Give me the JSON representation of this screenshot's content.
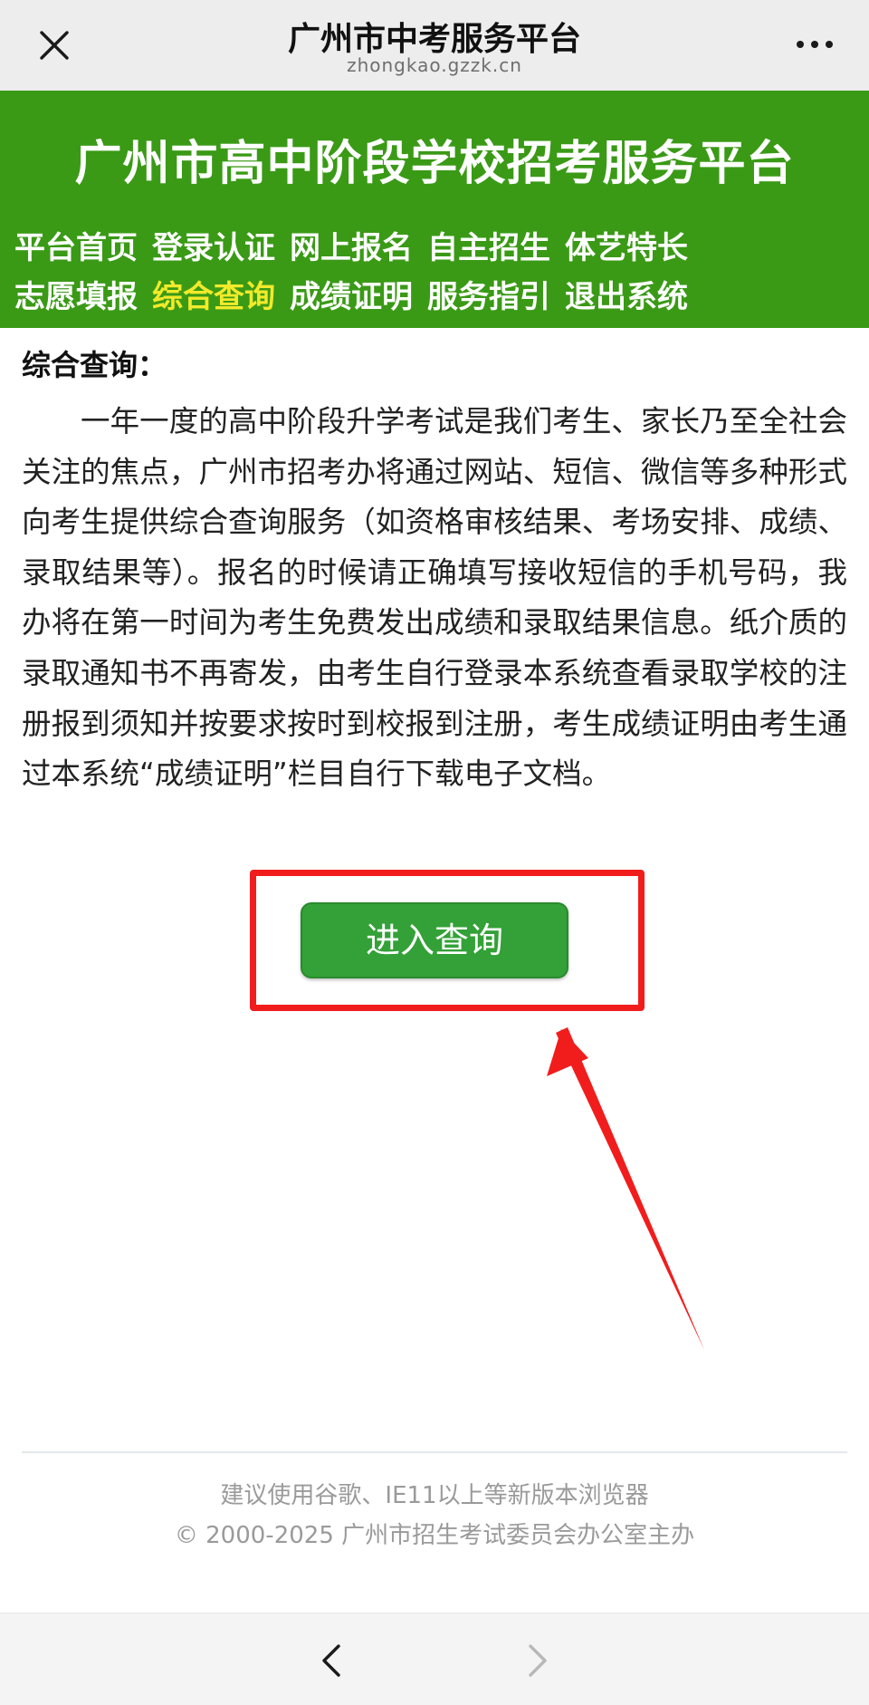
{
  "topbar": {
    "title": "广州市中考服务平台",
    "url": "zhongkao.gzzk.cn",
    "close_icon": "close-icon",
    "more_icon": "more-dots-icon"
  },
  "header": {
    "site_title": "广州市高中阶段学校招考服务平台",
    "background": "#3a9a16",
    "nav_row1": [
      "平台首页",
      "登录认证",
      "网上报名",
      "自主招生",
      "体艺特长"
    ],
    "nav_row2": [
      "志愿填报",
      "综合查询",
      "成绩证明",
      "服务指引",
      "退出系统"
    ],
    "active_item": "综合查询",
    "active_color": "#f2ea2a"
  },
  "content": {
    "section_title": "综合查询：",
    "paragraph": "一年一度的高中阶段升学考试是我们考生、家长乃至全社会关注的焦点，广州市招考办将通过网站、短信、微信等多种形式向考生提供综合查询服务（如资格审核结果、考场安排、成绩、录取结果等）。报名的时候请正确填写接收短信的手机号码，我办将在第一时间为考生免费发出成绩和录取结果信息。纸介质的录取通知书不再寄发，由考生自行登录本系统查看录取学校的注册报到须知并按要求按时到校报到注册，考生成绩证明由考生通过本系统“成绩证明”栏目自行下载电子文档。"
  },
  "button": {
    "label": "进入查询",
    "color": "#33a137",
    "highlight_color": "#f11d1d"
  },
  "footer": {
    "line1": "建议使用谷歌、IE11以上等新版本浏览器",
    "line2": "© 2000-2025 广州市招生考试委员会办公室主办"
  },
  "bottombar": {
    "back_icon": "chevron-left-icon",
    "forward_icon": "chevron-right-icon"
  }
}
